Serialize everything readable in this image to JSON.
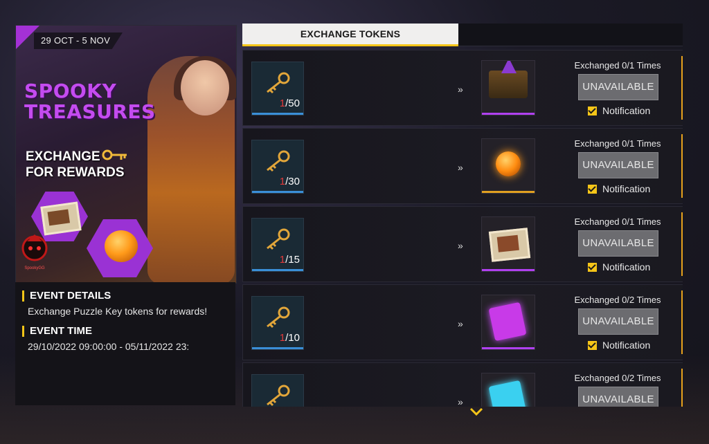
{
  "banner": {
    "date_range": "29 OCT - 5 NOV",
    "title_line1": "SPOOKY",
    "title_line2": "TREASURES",
    "subtitle_line1": "EXCHANGE",
    "subtitle_line2": "FOR REWARDS",
    "logo_text": "SpookyGG"
  },
  "details": {
    "event_details_heading": "EVENT DETAILS",
    "event_details_text": "Exchange Puzzle Key tokens for rewards!",
    "event_time_heading": "EVENT TIME",
    "event_time_text": "29/10/2022 09:00:00 - 05/11/2022 23:"
  },
  "tabs": {
    "active_label": "EXCHANGE TOKENS"
  },
  "rows": [
    {
      "have": "1",
      "need": "/50",
      "arrow": "»",
      "reward_icon": "witch-hat-chest-icon",
      "exchanged": "Exchanged 0/1 Times",
      "button": "UNAVAILABLE",
      "notification": "Notification"
    },
    {
      "have": "1",
      "need": "/30",
      "arrow": "»",
      "reward_icon": "pumpkin-bat-icon",
      "exchanged": "Exchanged 0/1 Times",
      "button": "UNAVAILABLE",
      "notification": "Notification"
    },
    {
      "have": "1",
      "need": "/15",
      "arrow": "»",
      "reward_icon": "photo-frame-icon",
      "exchanged": "Exchanged 0/1 Times",
      "button": "UNAVAILABLE",
      "notification": "Notification"
    },
    {
      "have": "1",
      "need": "/10",
      "arrow": "»",
      "reward_icon": "weapon-ticket-icon",
      "exchanged": "Exchanged 0/2 Times",
      "button": "UNAVAILABLE",
      "notification": "Notification"
    },
    {
      "have": "",
      "need": "",
      "arrow": "»",
      "reward_icon": "diamond-ticket-icon",
      "exchanged": "Exchanged 0/2 Times",
      "button": "UNAVAILABLE",
      "notification": ""
    }
  ],
  "colors": {
    "accent_purple": "#a431d6",
    "accent_gold": "#f5c518",
    "token_red": "#e23a3a",
    "button_gray": "#6c6c70"
  }
}
